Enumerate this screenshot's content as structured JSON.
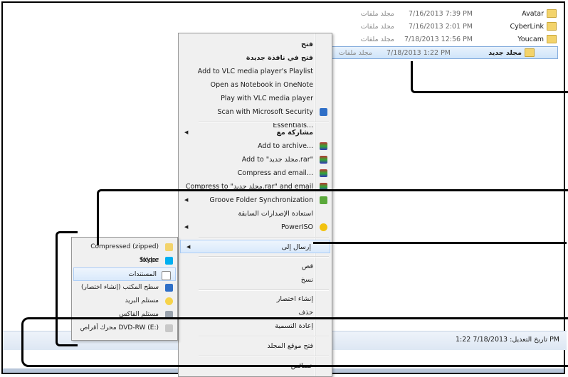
{
  "files": [
    {
      "name": "Avatar",
      "date": "7/16/2013 7:39 PM",
      "type": "مجلد ملفات"
    },
    {
      "name": "CyberLink",
      "date": "7/16/2013 2:01 PM",
      "type": "مجلد ملفات"
    },
    {
      "name": "Youcam",
      "date": "7/18/2013 12:56 PM",
      "type": "مجلد ملفات"
    },
    {
      "name": "مجلد جديد",
      "date": "7/18/2013 1:22 PM",
      "type": "مجلد ملفات"
    }
  ],
  "context_menu": {
    "items": [
      {
        "label": "فتح"
      },
      {
        "label": "فتح في نافذة جديدة"
      },
      {
        "label": "Add to VLC media player's Playlist"
      },
      {
        "label": "Open as Notebook in OneNote"
      },
      {
        "label": "Play with VLC media player"
      },
      {
        "label": "Scan with Microsoft Security Essentials..."
      },
      {
        "label": "مشاركة مع"
      },
      {
        "label": "Add to archive..."
      },
      {
        "label": "Add to \"مجلد جديد.rar\""
      },
      {
        "label": "Compress and email..."
      },
      {
        "label": "Compress to \"مجلد جديد.rar\" and email"
      },
      {
        "label": "Groove Folder Synchronization"
      },
      {
        "label": "استعادة الإصدارات السابقة"
      },
      {
        "label": "PowerISO"
      },
      {
        "label": "إرسال إلى"
      },
      {
        "label": "قص"
      },
      {
        "label": "نسخ"
      },
      {
        "label": "إنشاء اختصار"
      },
      {
        "label": "حذف"
      },
      {
        "label": "إعادة التسمية"
      },
      {
        "label": "فتح موقع المجلد"
      },
      {
        "label": "خصائص"
      }
    ]
  },
  "send_to_menu": {
    "items": [
      {
        "label": "Compressed (zipped) folder"
      },
      {
        "label": "Skype"
      },
      {
        "label": "المستندات"
      },
      {
        "label": "سطح المكتب (إنشاء اختصار)"
      },
      {
        "label": "مستلم البريد"
      },
      {
        "label": "مستلم الفاكس"
      },
      {
        "label": "محرك أقراص DVD-RW (E:)"
      }
    ]
  },
  "status_bar": {
    "text": "تاريخ التعديل: 7/18/2013 1:22 PM"
  }
}
